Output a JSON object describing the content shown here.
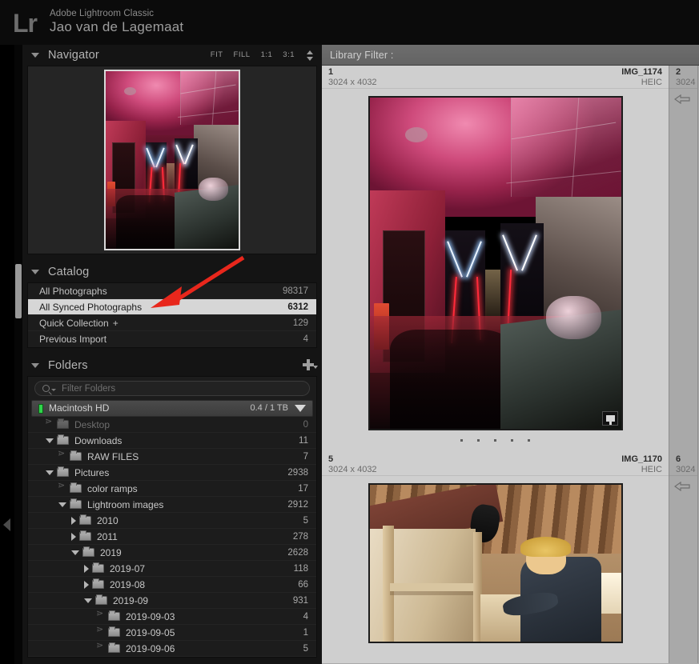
{
  "identity": {
    "logo_text": "Lr",
    "app_name": "Adobe Lightroom Classic",
    "user_name": "Jao van de Lagemaat"
  },
  "navigator": {
    "title": "Navigator",
    "modes": [
      "FIT",
      "FILL",
      "1:1",
      "3:1"
    ]
  },
  "catalog": {
    "title": "Catalog",
    "rows": [
      {
        "label": "All Photographs",
        "count": "98317",
        "selected": false
      },
      {
        "label": "All Synced Photographs",
        "count": "6312",
        "selected": true
      },
      {
        "label": "Quick Collection",
        "plus": "+",
        "count": "129",
        "selected": false
      },
      {
        "label": "Previous Import",
        "count": "4",
        "selected": false
      }
    ]
  },
  "folders": {
    "title": "Folders",
    "filter_placeholder": "Filter Folders",
    "volume": {
      "name": "Macintosh HD",
      "space": "0.4 / 1 TB"
    },
    "tree": [
      {
        "label": "Desktop",
        "count": "0",
        "indent": 1,
        "state": "leaf",
        "dim": true
      },
      {
        "label": "Downloads",
        "count": "11",
        "indent": 1,
        "state": "expanded",
        "dim": false
      },
      {
        "label": "RAW FILES",
        "count": "7",
        "indent": 2,
        "state": "leaf",
        "dim": false
      },
      {
        "label": "Pictures",
        "count": "2938",
        "indent": 1,
        "state": "expanded",
        "dim": false
      },
      {
        "label": "color ramps",
        "count": "17",
        "indent": 2,
        "state": "leaf",
        "dim": false
      },
      {
        "label": "Lightroom images",
        "count": "2912",
        "indent": 2,
        "state": "expanded",
        "dim": false
      },
      {
        "label": "2010",
        "count": "5",
        "indent": 3,
        "state": "collapsed",
        "dim": false
      },
      {
        "label": "2011",
        "count": "278",
        "indent": 3,
        "state": "collapsed",
        "dim": false
      },
      {
        "label": "2019",
        "count": "2628",
        "indent": 3,
        "state": "expanded",
        "dim": false
      },
      {
        "label": "2019-07",
        "count": "118",
        "indent": 4,
        "state": "collapsed",
        "dim": false
      },
      {
        "label": "2019-08",
        "count": "66",
        "indent": 4,
        "state": "collapsed",
        "dim": false
      },
      {
        "label": "2019-09",
        "count": "931",
        "indent": 4,
        "state": "expanded",
        "dim": false
      },
      {
        "label": "2019-09-03",
        "count": "4",
        "indent": 5,
        "state": "leaf",
        "dim": false
      },
      {
        "label": "2019-09-05",
        "count": "1",
        "indent": 5,
        "state": "leaf",
        "dim": false
      },
      {
        "label": "2019-09-06",
        "count": "5",
        "indent": 5,
        "state": "leaf",
        "dim": false
      }
    ]
  },
  "library_filter": {
    "label": "Library Filter :"
  },
  "grid": {
    "cells": [
      {
        "index": "1",
        "dimensions": "3024 x 4032",
        "filename": "IMG_1174",
        "format": "HEIC",
        "selected": true
      },
      {
        "index": "2",
        "dimensions": "3024",
        "filename": "",
        "format": "",
        "selected": false
      },
      {
        "index": "5",
        "dimensions": "3024 x 4032",
        "filename": "IMG_1170",
        "format": "HEIC",
        "selected": true
      },
      {
        "index": "6",
        "dimensions": "3024",
        "filename": "",
        "format": "",
        "selected": false
      }
    ]
  },
  "annotation": {
    "arrow_color": "#e8271c",
    "points_to": "All Synced Photographs"
  },
  "colors": {
    "panel_background": "#141414",
    "grid_background": "#a9a9a9",
    "selection_highlight": "#d6d6d6",
    "volume_led": "#2fd44a"
  }
}
